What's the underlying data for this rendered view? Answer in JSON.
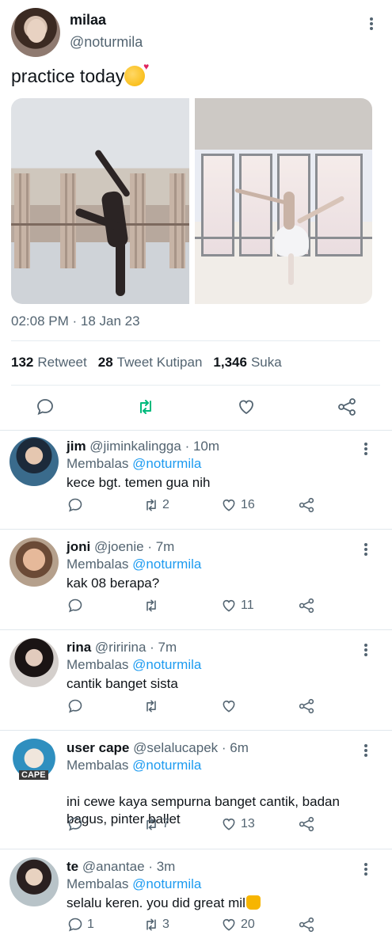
{
  "tweet": {
    "author_name": "milaa",
    "author_handle": "@noturmila",
    "text": "practice today",
    "timestamp": "02:08 PM · 18 Jan 23",
    "stats": {
      "retweets": "132",
      "retweets_label": "Retweet",
      "quotes": "28",
      "quotes_label": "Tweet Kutipan",
      "likes": "1,346",
      "likes_label": "Suka"
    }
  },
  "replies": [
    {
      "name": "jim",
      "handle": "@jiminkalingga",
      "time": "· 10m",
      "replying_label": "Membalas",
      "replying_to": "@noturmila",
      "text": "kece bgt. temen gua nih",
      "reply_count": "",
      "retweet_count": "2",
      "like_count": "16"
    },
    {
      "name": "joni",
      "handle": "@joenie",
      "time": "· 7m",
      "replying_label": "Membalas",
      "replying_to": "@noturmila",
      "text": "kak 08 berapa?",
      "reply_count": "",
      "retweet_count": "",
      "like_count": "11"
    },
    {
      "name": "rina",
      "handle": "@riririna",
      "time": "· 7m",
      "replying_label": "Membalas",
      "replying_to": "@noturmila",
      "text": "cantik banget sista",
      "reply_count": "",
      "retweet_count": "",
      "like_count": ""
    },
    {
      "name": "user cape",
      "handle": "@selalucapek",
      "time": "· 6m",
      "replying_label": "Membalas",
      "replying_to": "@noturmila",
      "text": "ini cewe kaya sempurna banget cantik, badan bagus, pinter ballet",
      "reply_count": "",
      "retweet_count": "7",
      "like_count": "13",
      "avatar_text": "CAPE"
    },
    {
      "name": "te",
      "handle": "@anantae",
      "time": "· 3m",
      "replying_label": "Membalas",
      "replying_to": "@noturmila",
      "text": "selalu keren. you did great mil",
      "reply_count": "1",
      "retweet_count": "3",
      "like_count": "20"
    }
  ],
  "colors": {
    "accent": "#1d9bf0",
    "retweet_active": "#00ba7c",
    "secondary_text": "#536471"
  }
}
